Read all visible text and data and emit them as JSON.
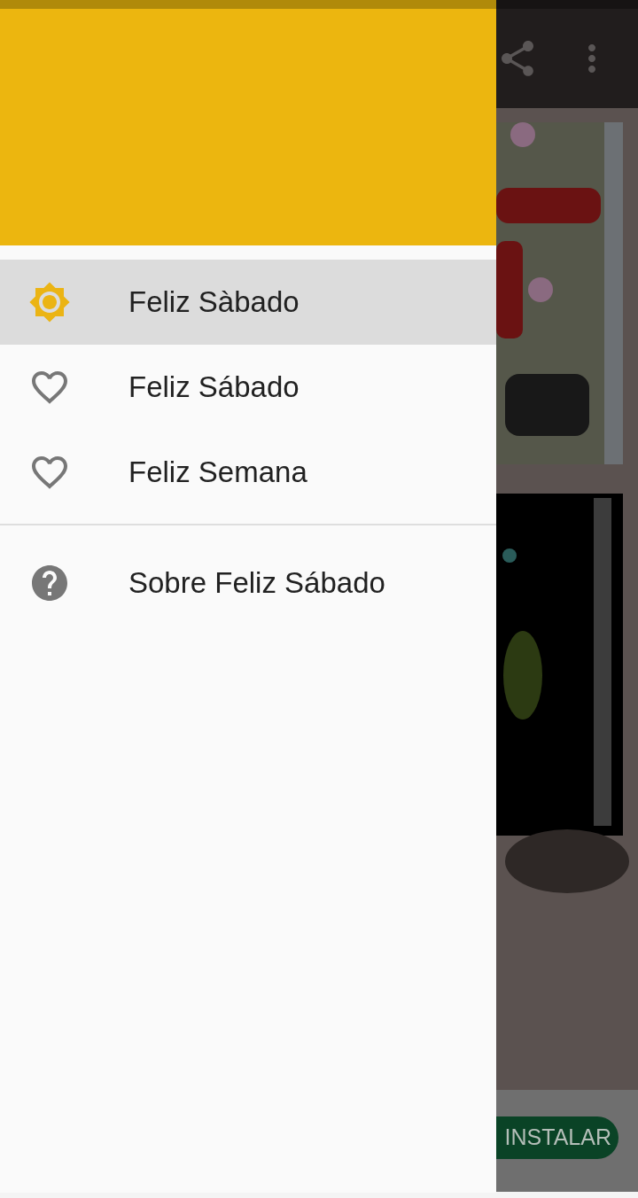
{
  "app_bar": {
    "actions": [
      {
        "kind": "share"
      },
      {
        "kind": "more"
      }
    ]
  },
  "ad_banner": {
    "button": "INSTALAR"
  },
  "drawer": {
    "primary_items": [
      {
        "label": "Feliz Sàbado",
        "kind": "sun",
        "selected": true
      },
      {
        "label": "Feliz Sábado",
        "kind": "heart",
        "selected": false
      },
      {
        "label": "Feliz Semana",
        "kind": "heart",
        "selected": false
      }
    ],
    "secondary_items": [
      {
        "label": "Sobre Feliz Sábado",
        "kind": "help",
        "selected": false
      }
    ]
  }
}
